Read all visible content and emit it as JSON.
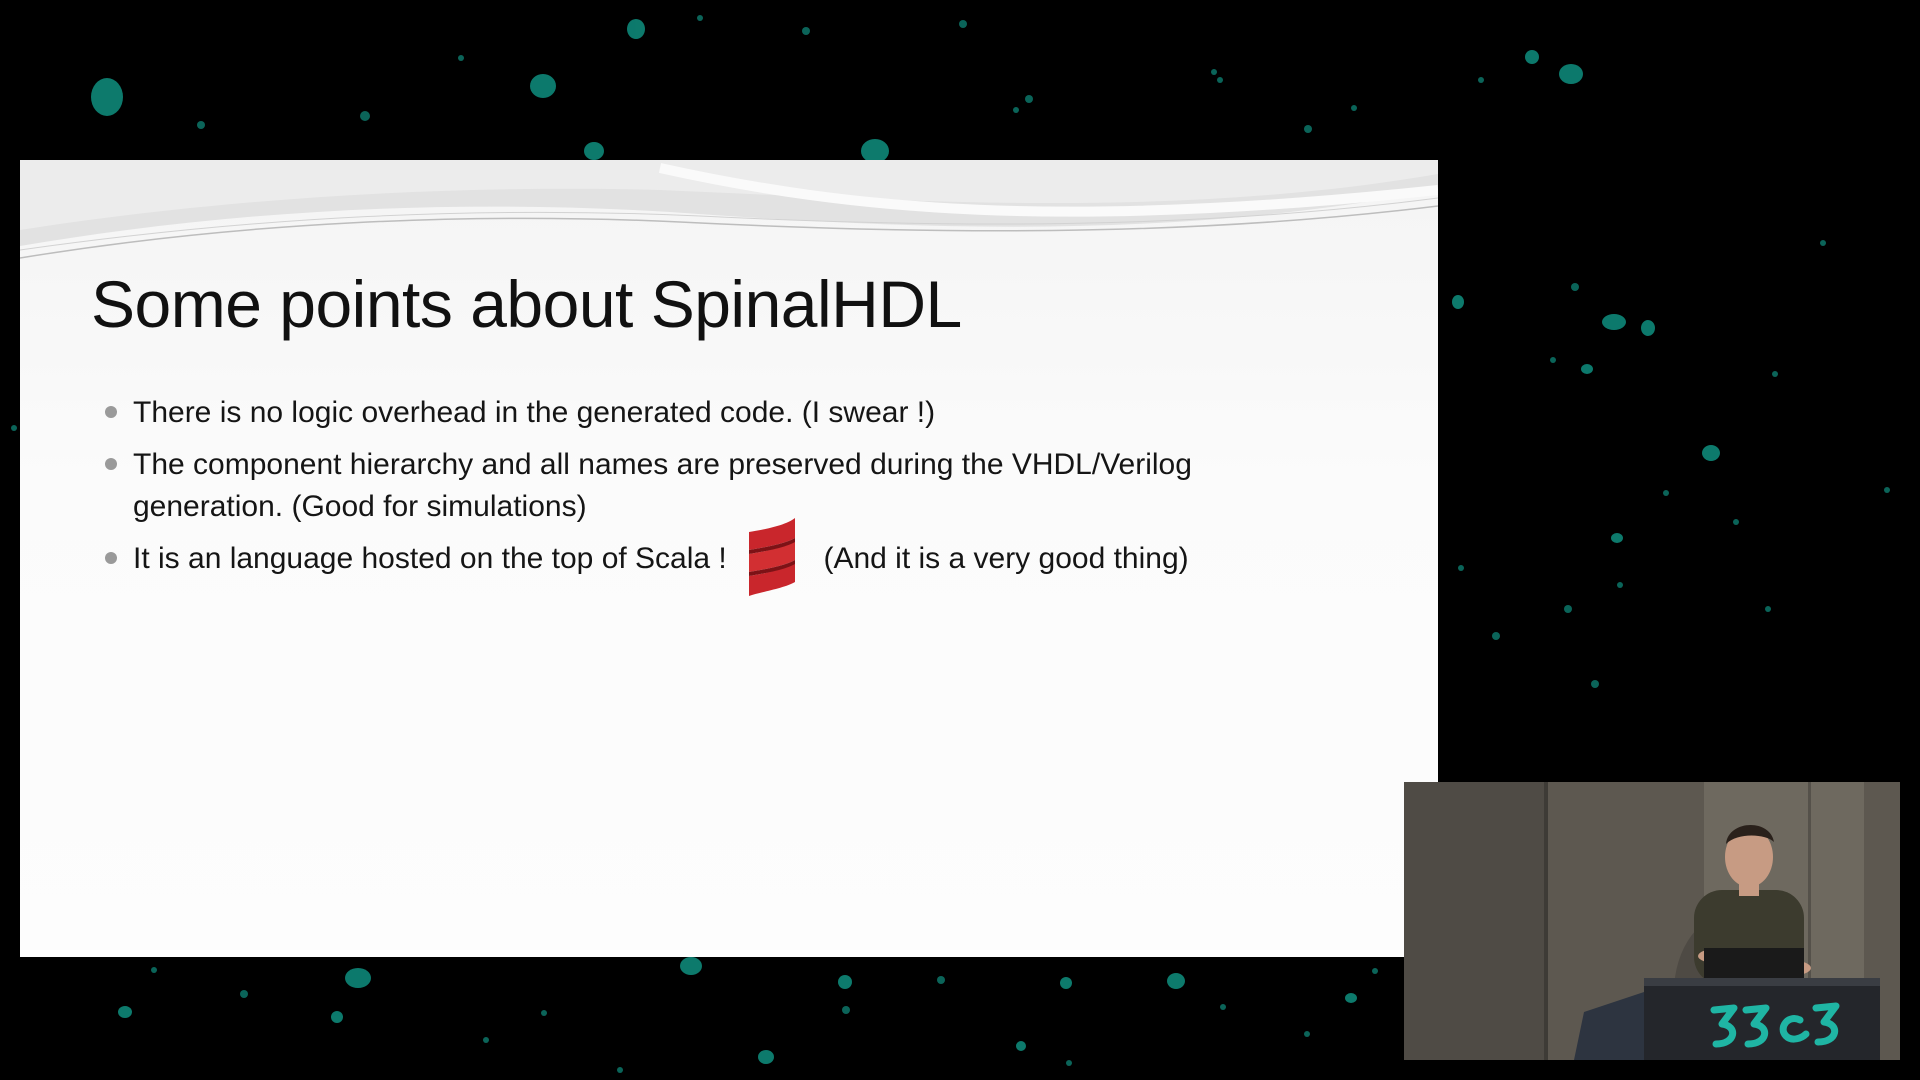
{
  "slide": {
    "title": "Some points about SpinalHDL",
    "bullets": [
      {
        "text": "There is no logic overhead in the generated code. (I swear !)"
      },
      {
        "text": "The component hierarchy and all names are preserved during the VHDL/Verilog generation. (Good for simulations)"
      },
      {
        "text_before_logo": "It is an language hosted on the top of Scala !",
        "logo_icon": "scala-logo-icon",
        "text_after_logo": "(And it is a very good thing)"
      }
    ]
  },
  "speaker_cam": {
    "podium_icon": "33c3-logo-icon"
  },
  "colors": {
    "backdrop": "#000000",
    "dot_accent": "#0f8f7f",
    "slide_bg": "#fbfbfb",
    "scala_red": "#c9262c"
  }
}
